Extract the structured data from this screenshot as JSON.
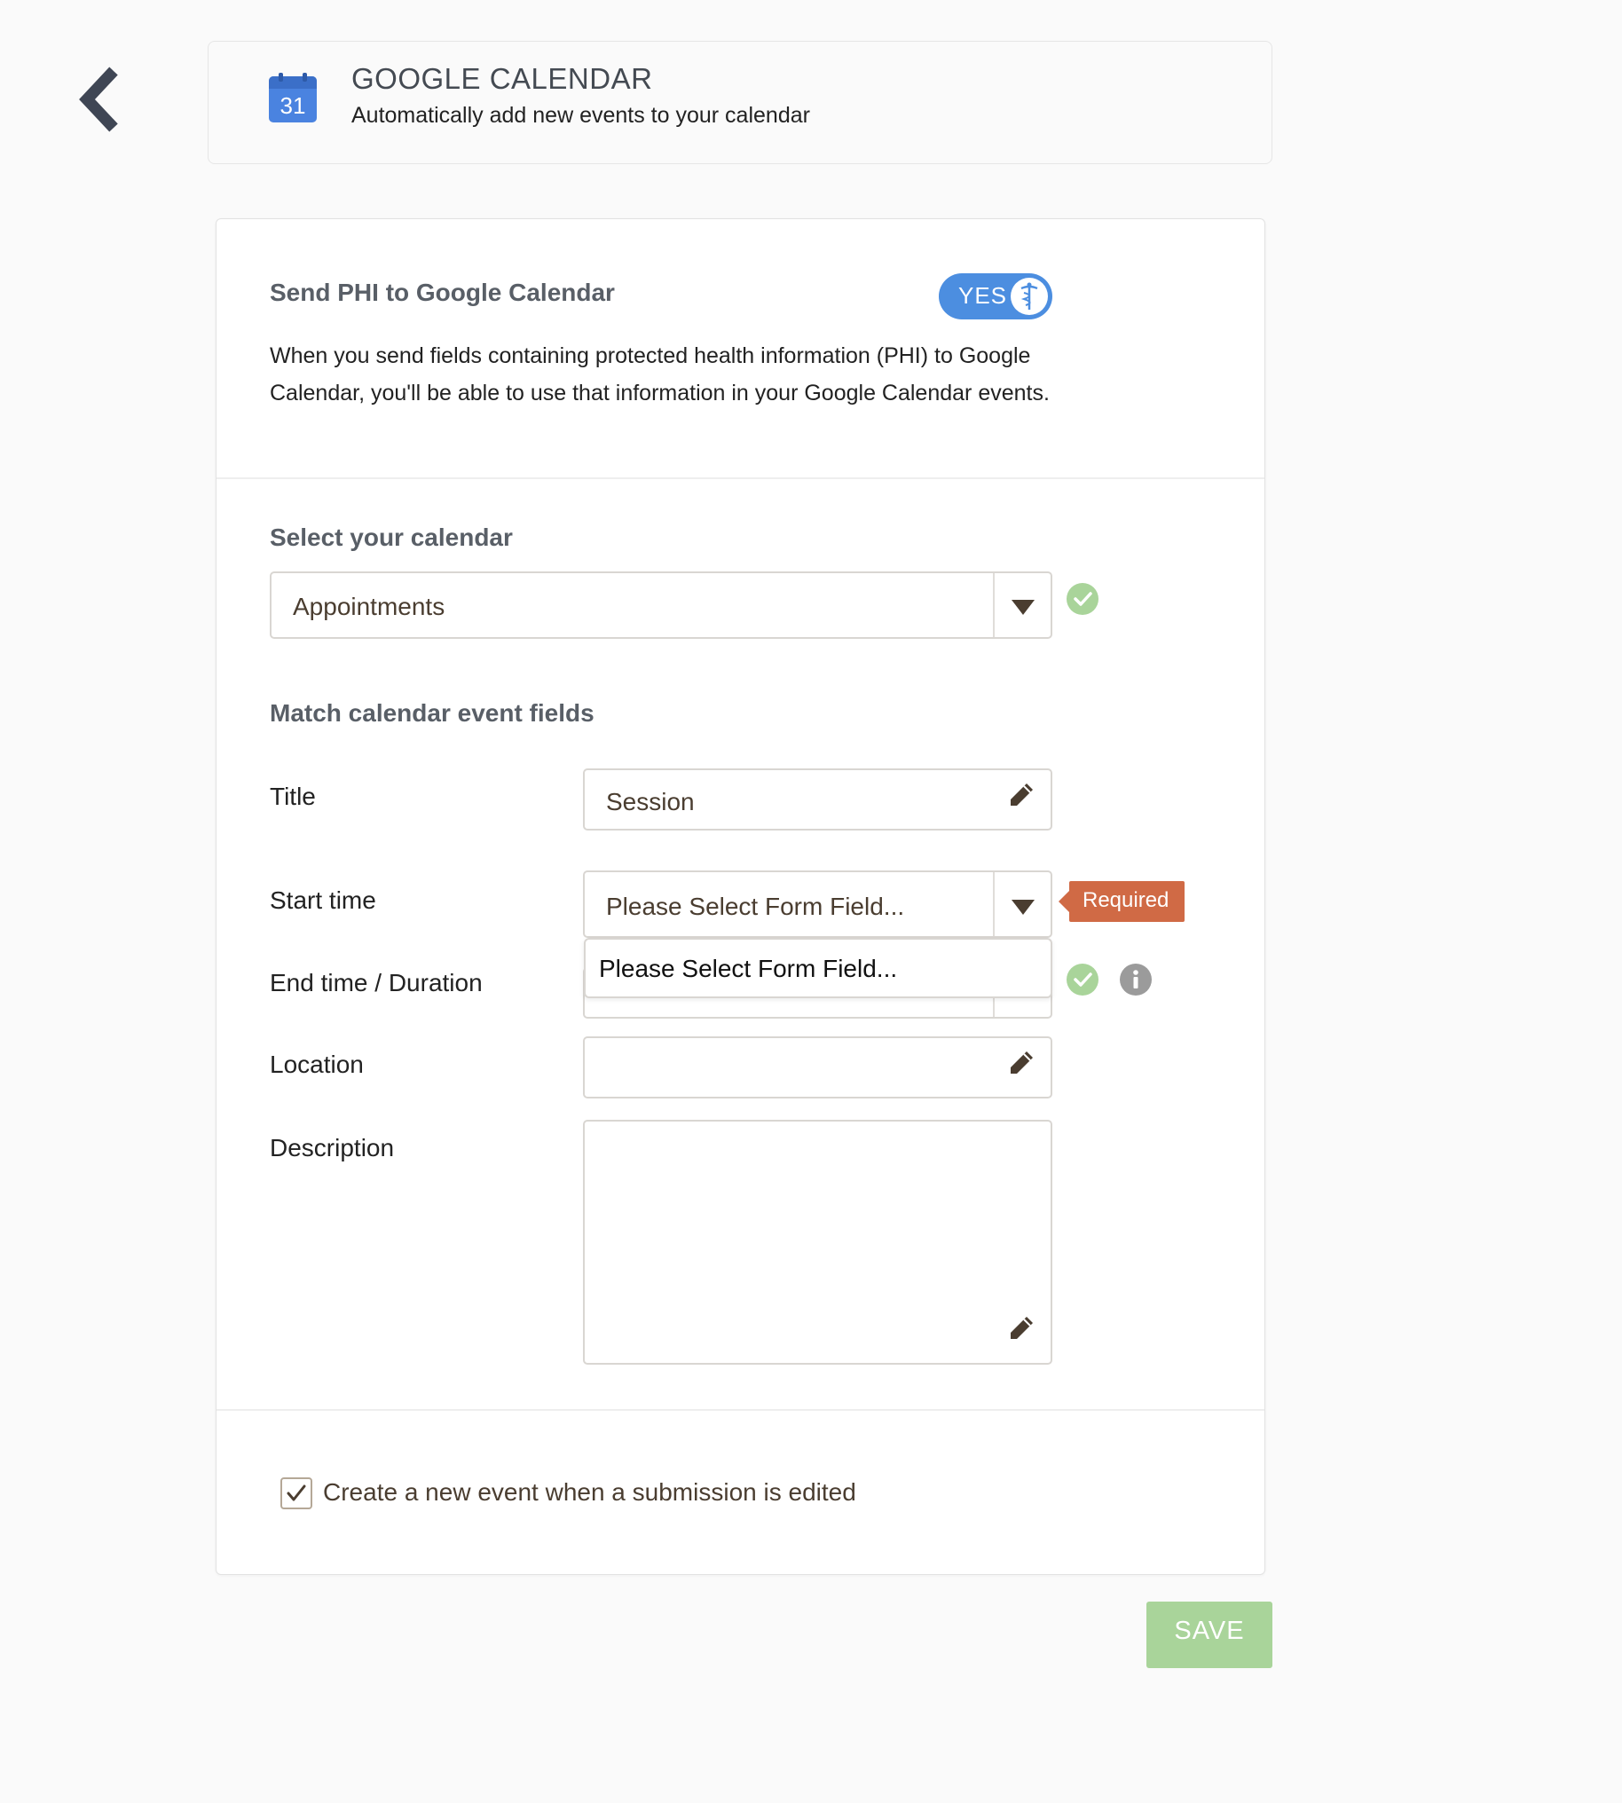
{
  "header": {
    "app_title": "GOOGLE CALENDAR",
    "app_subtitle": "Automatically add new events to your calendar",
    "calendar_icon_day": "31"
  },
  "phi": {
    "title": "Send PHI to Google Calendar",
    "toggle_label": "YES",
    "description": "When you send fields containing protected health information (PHI) to Google Calendar, you'll be able to use that information in your Google Calendar events."
  },
  "calendar": {
    "label": "Select your calendar",
    "selected": "Appointments"
  },
  "fields": {
    "section_title": "Match calendar event fields",
    "title_label": "Title",
    "title_value": "Session",
    "start_label": "Start time",
    "start_value": "Please Select Form Field...",
    "start_required": "Required",
    "start_option": "Please Select Form Field...",
    "end_label": "End time / Duration",
    "location_label": "Location",
    "description_label": "Description"
  },
  "options": {
    "new_event_on_edit_label": "Create a new event when a submission is edited",
    "new_event_on_edit_checked": true
  },
  "actions": {
    "save_label": "SAVE"
  },
  "colors": {
    "toggle_blue": "#4c8ee0",
    "required_orange": "#d06a45",
    "check_green": "#a9d49a",
    "save_green": "#a9d49a"
  }
}
